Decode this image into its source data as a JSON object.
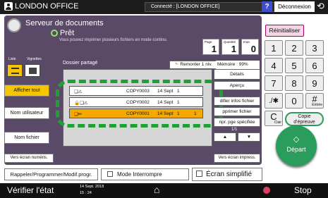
{
  "topbar": {
    "title": "LONDON OFFICE",
    "connection": "Connecté : [LONDON OFFICE]",
    "help": "?",
    "logout": "Déconnexion"
  },
  "header": {
    "app_title": "Serveur de documents",
    "status": "Prêt",
    "subtitle": "Vous pouvez imprimer plusieurs fichiers en mode continu.",
    "page_label": "Page",
    "page_value": "1",
    "quantity_label": "Quantité",
    "quantity_value": "1",
    "print_label": "Impr.",
    "print_value": "0"
  },
  "view": {
    "list_label": "Liste",
    "thumb_label": "Vignettes"
  },
  "folder": {
    "name": "Dossier partagé",
    "up_button": "Remonter 1 niv.",
    "memory": "Mémoire :  99%"
  },
  "files": [
    {
      "icons": "❏⚠",
      "name": "COPY0003",
      "date": "14 Sept",
      "qty": "1",
      "selected": false
    },
    {
      "icons": "🔒❏⚠",
      "name": "COPY0002",
      "date": "14 Sept",
      "qty": "1",
      "selected": false
    },
    {
      "icons": "❏✏",
      "name": "COPY0001",
      "date": "14 Sept",
      "qty": "1",
      "qty2": "1",
      "selected": true
    }
  ],
  "side": {
    "show_all": "Afficher tout",
    "user_name": "Nom utilisateur",
    "file_name": "Nom fichier",
    "scan_screen": "Vers écran numéris."
  },
  "right": {
    "details": "Détails",
    "preview": "Aperçu",
    "edit_info": "difier infos fichier",
    "delete": "pprimer fichier",
    "print_page": "npr. pge spécifiée",
    "page_count": "1/1",
    "print_screen": "Vers écran impress."
  },
  "bottom": {
    "recall": "Rappeler/Programmer/Modif.progr.",
    "interrupt": "Mode Interrompre",
    "simple": "Écran simplifié"
  },
  "keypad": {
    "reset": "Réinitialiser",
    "keys": [
      "1",
      "2",
      "3",
      "4",
      "5",
      "6",
      "7",
      "8",
      "9",
      "./✱",
      "0",
      "#"
    ],
    "enter": "Entrée",
    "clear": "C",
    "clear_label": "Clair",
    "clear_mode_1": "Copie",
    "clear_mode_2": "d'épreuve",
    "start": "Départ"
  },
  "footer": {
    "check_status": "Vérifier l'état",
    "date": "14 Sept. 2018",
    "time": "15 : 24",
    "stop": "Stop"
  }
}
